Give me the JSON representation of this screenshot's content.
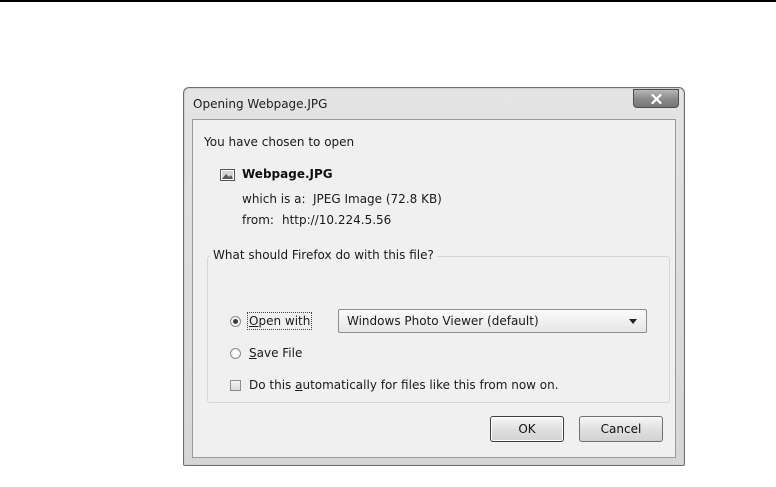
{
  "dialog": {
    "title": "Opening Webpage.JPG",
    "close_icon": "close-icon"
  },
  "file": {
    "intro": "You have chosen to open",
    "icon": "image-file-icon",
    "name": "Webpage.JPG",
    "type_label": "which is a:",
    "type_value": "JPEG Image (72.8 KB)",
    "from_label": "from:",
    "from_value": "http://10.224.5.56"
  },
  "action": {
    "question": "What should Firefox do with this file?",
    "open_with": {
      "label_prefix": "",
      "label_mnemonic": "O",
      "label_rest": "pen with",
      "selected": true
    },
    "app_select": {
      "value": "Windows Photo Viewer (default)"
    },
    "save_file": {
      "label_mnemonic": "S",
      "label_rest": "ave File",
      "selected": false
    },
    "auto": {
      "label_before": "Do this ",
      "label_mnemonic": "a",
      "label_after": "utomatically for files like this from now on.",
      "checked": false
    }
  },
  "buttons": {
    "ok": "OK",
    "cancel": "Cancel"
  }
}
